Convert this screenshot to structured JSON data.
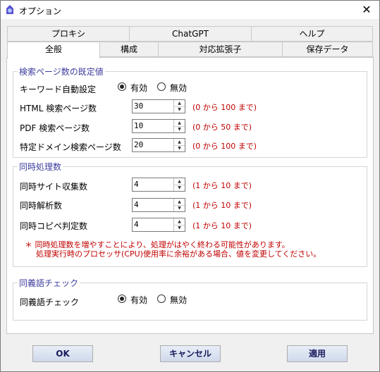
{
  "window": {
    "title": "オプション",
    "close_glyph": "✕"
  },
  "tabs_back": [
    "プロキシ",
    "ChatGPT",
    "ヘルプ"
  ],
  "tabs_front": [
    "全般",
    "構成",
    "対応拡張子",
    "保存データ"
  ],
  "group_search": {
    "title": "検索ページ数の既定値",
    "keyword_label": "キーワード自動設定",
    "radio_on": "有効",
    "radio_off": "無効",
    "rows": [
      {
        "label": "HTML 検索ページ数",
        "value": "30",
        "range": "(0 から 100 まで)"
      },
      {
        "label": "PDF 検索ページ数",
        "value": "10",
        "range": "(0 から 50 まで)"
      },
      {
        "label": "特定ドメイン検索ページ数",
        "value": "20",
        "range": "(0 から 100 まで)"
      }
    ]
  },
  "group_parallel": {
    "title": "同時処理数",
    "rows": [
      {
        "label": "同時サイト収集数",
        "value": "4",
        "range": "(1 から 10 まで)"
      },
      {
        "label": "同時解析数",
        "value": "4",
        "range": "(1 から 10 まで)"
      },
      {
        "label": "同時コピペ判定数",
        "value": "4",
        "range": "(1 から 10 まで)"
      }
    ],
    "note_line1": "＊ 同時処理数を増やすことにより、処理がはやく終わる可能性があります。",
    "note_line2": "処理実行時のプロセッサ(CPU)使用率に余裕がある場合、値を変更してください。"
  },
  "group_synonym": {
    "title": "同義語チェック",
    "label": "同義語チェック",
    "radio_on": "有効",
    "radio_off": "無効"
  },
  "buttons": {
    "ok": "OK",
    "cancel": "キャンセル",
    "apply": "適用"
  },
  "spin_arrows": {
    "up": "▲",
    "down": "▼"
  }
}
